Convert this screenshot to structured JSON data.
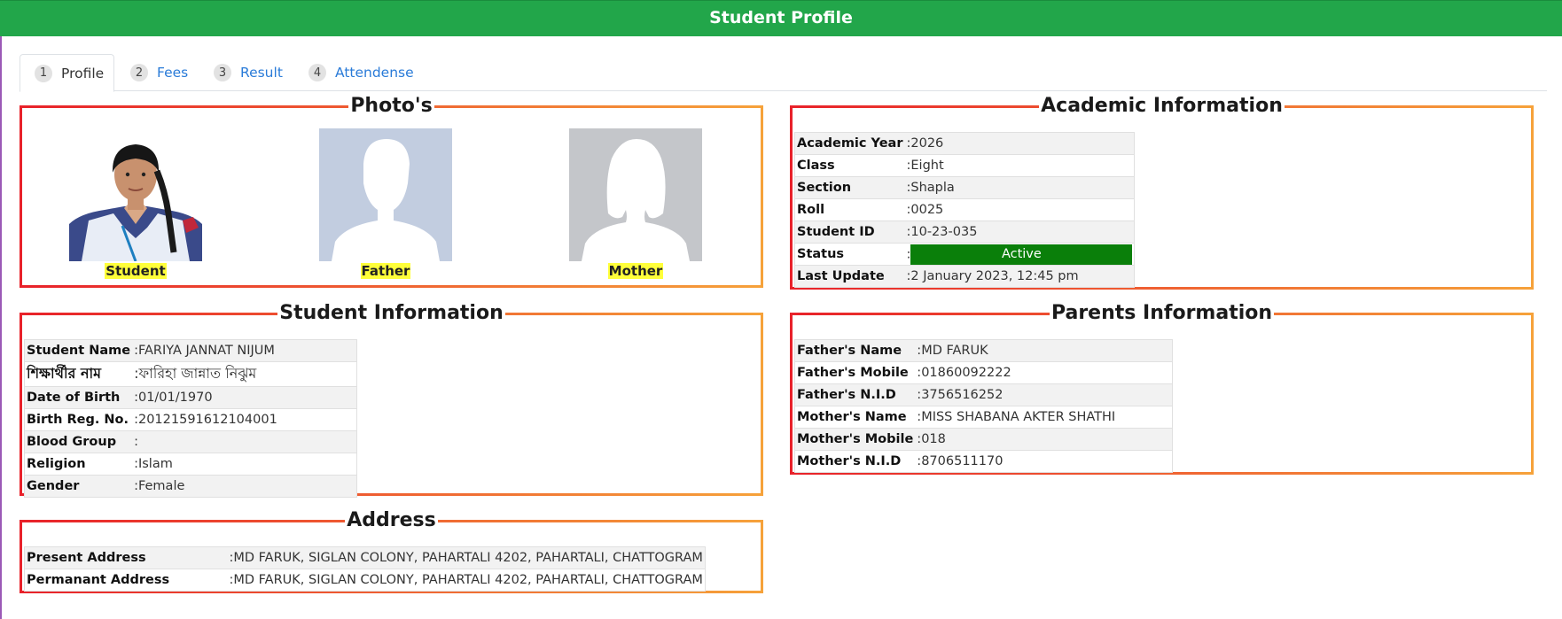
{
  "header": {
    "title": "Student Profile"
  },
  "tabs": [
    {
      "num": "1",
      "label": "Profile"
    },
    {
      "num": "2",
      "label": "Fees"
    },
    {
      "num": "3",
      "label": "Result"
    },
    {
      "num": "4",
      "label": "Attendense"
    }
  ],
  "photos": {
    "title": "Photo's",
    "student": "Student",
    "father": "Father",
    "mother": "Mother"
  },
  "academic": {
    "title": "Academic Information",
    "rows": [
      {
        "label": "Academic Year",
        "value": "2026"
      },
      {
        "label": "Class",
        "value": "Eight"
      },
      {
        "label": "Section",
        "value": "Shapla"
      },
      {
        "label": "Roll",
        "value": "0025"
      },
      {
        "label": "Student ID",
        "value": "10-23-035"
      },
      {
        "label": "Status",
        "value": "Active"
      },
      {
        "label": "Last Update",
        "value": "2 January 2023, 12:45 pm"
      }
    ],
    "status_color": "#0a7f0a"
  },
  "student_info": {
    "title": "Student Information",
    "rows": [
      {
        "label": "Student Name",
        "value": "FARIYA JANNAT NIJUM"
      },
      {
        "label": "শিক্ষার্থীর নাম",
        "value": "ফারিহা জান্নাত নিঝুম"
      },
      {
        "label": "Date of Birth",
        "value": "01/01/1970"
      },
      {
        "label": "Birth Reg. No.",
        "value": "20121591612104001"
      },
      {
        "label": "Blood Group",
        "value": ""
      },
      {
        "label": "Religion",
        "value": "Islam"
      },
      {
        "label": "Gender",
        "value": "Female"
      }
    ]
  },
  "parents": {
    "title": "Parents Information",
    "rows": [
      {
        "label": "Father's Name",
        "value": "MD FARUK"
      },
      {
        "label": "Father's Mobile",
        "value": "01860092222"
      },
      {
        "label": "Father's N.I.D",
        "value": "3756516252"
      },
      {
        "label": "Mother's Name",
        "value": "MISS SHABANA AKTER SHATHI"
      },
      {
        "label": "Mother's Mobile",
        "value": "018"
      },
      {
        "label": "Mother's N.I.D",
        "value": "8706511170"
      }
    ]
  },
  "address": {
    "title": "Address",
    "rows": [
      {
        "label": "Present Address",
        "value": "MD FARUK, SIGLAN COLONY, PAHARTALI 4202, PAHARTALI, CHATTOGRAM"
      },
      {
        "label": "Permanant Address",
        "value": "MD FARUK, SIGLAN COLONY, PAHARTALI 4202, PAHARTALI, CHATTOGRAM"
      }
    ]
  },
  "colors": {
    "header_bg": "#22a64a",
    "tab_link": "#2a7bd8",
    "border_gradient_start": "#e8212a",
    "border_gradient_end": "#f6a23a",
    "caption_highlight": "#ffff3a"
  }
}
